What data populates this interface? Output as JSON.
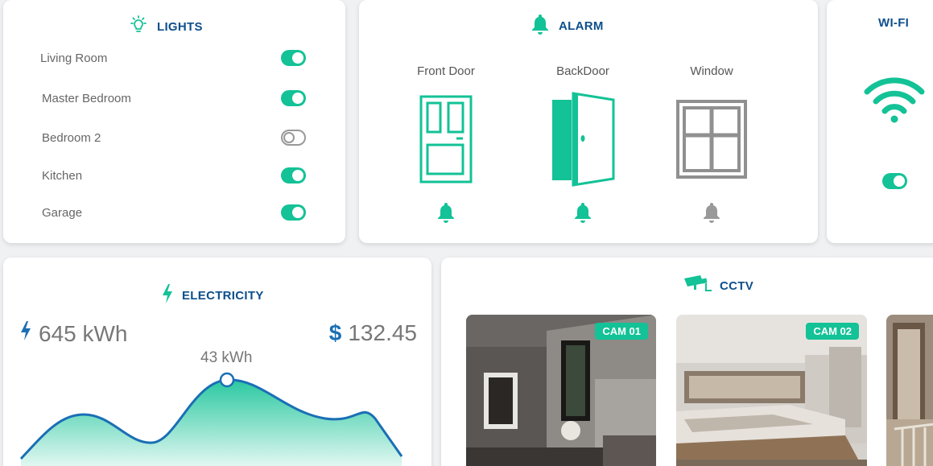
{
  "lights": {
    "title": "LIGHTS",
    "icon": "lightbulb-icon",
    "items": [
      {
        "label": "Living Room",
        "on": true
      },
      {
        "label": "Master Bedroom",
        "on": true
      },
      {
        "label": "Bedroom 2",
        "on": false
      },
      {
        "label": "Kitchen",
        "on": true
      },
      {
        "label": "Garage",
        "on": true
      }
    ]
  },
  "alarm": {
    "title": "ALARM",
    "icon": "bell-icon",
    "items": [
      {
        "label": "Front Door",
        "icon": "front-door-icon",
        "active": true
      },
      {
        "label": "BackDoor",
        "icon": "open-door-icon",
        "active": true
      },
      {
        "label": "Window",
        "icon": "window-icon",
        "active": false
      }
    ]
  },
  "wifi": {
    "title": "WI-FI",
    "icon": "wifi-icon",
    "on": true
  },
  "electricity": {
    "title": "ELECTRICITY",
    "icon": "lightning-icon",
    "usage": "645 kWh",
    "cost_symbol": "$",
    "cost": "132.45",
    "peak_label": "43 kWh"
  },
  "cctv": {
    "title": "CCTV",
    "icon": "security-camera-icon",
    "cameras": [
      {
        "label": "CAM 01"
      },
      {
        "label": "CAM 02"
      }
    ]
  },
  "colors": {
    "accent": "#13c296",
    "title": "#0d4f8b",
    "inactive": "#999999"
  }
}
